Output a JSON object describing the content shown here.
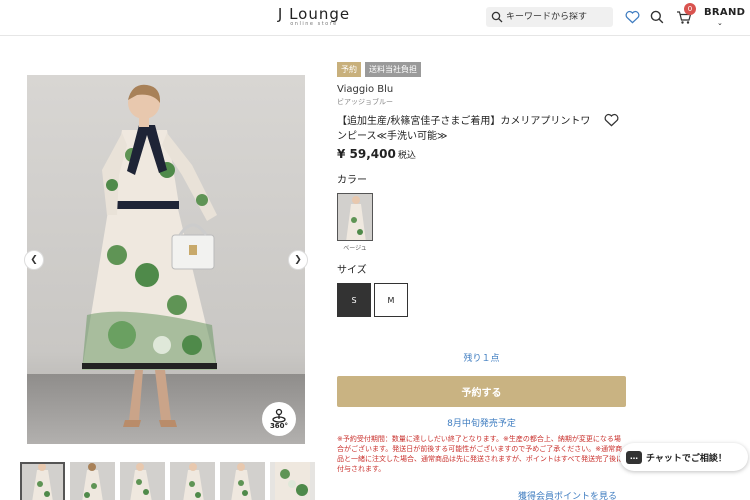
{
  "header": {
    "logo": "J Lounge",
    "logo_sub": "online store",
    "search_placeholder": "キーワードから探す",
    "cart_count": "0",
    "brand_menu": "BRAND"
  },
  "gallery": {
    "badge_360": "360°",
    "prev_icon": "chevron-left-icon",
    "next_icon": "chevron-right-icon"
  },
  "product": {
    "tags": [
      "予約",
      "送料当社負担"
    ],
    "brand": "Viaggio Blu",
    "brand_kana": "ビアッジョブルー",
    "title": "【追加生産/秋篠宮佳子さまご着用】カメリアプリントワンピース≪手洗い可能≫",
    "price": "¥ 59,400",
    "tax": "税込",
    "color_label": "カラー",
    "color_name": "ベージュ",
    "size_label": "サイズ",
    "sizes": [
      "S",
      "M"
    ],
    "stock": "残り１点",
    "reserve_button": "予約する",
    "release": "8月中旬発売予定",
    "notes": "※予約受付期間：数量に達ししだい終了となります。※生産の都合上、納期が変更になる場合がございます。発送日が前後する可能性がございますので予めご了承ください。※通常商品と一緒に注文した場合、通常商品は先に発送されますが、ポイントはすべて発送完了後に付与されます。",
    "points_link": "獲得会員ポイントを見る"
  },
  "chat": {
    "label": "チャットでご相談！"
  },
  "colors": {
    "accent_gold": "#c9b382",
    "link_blue": "#3e7cc0",
    "notice_red": "#c9302c"
  }
}
